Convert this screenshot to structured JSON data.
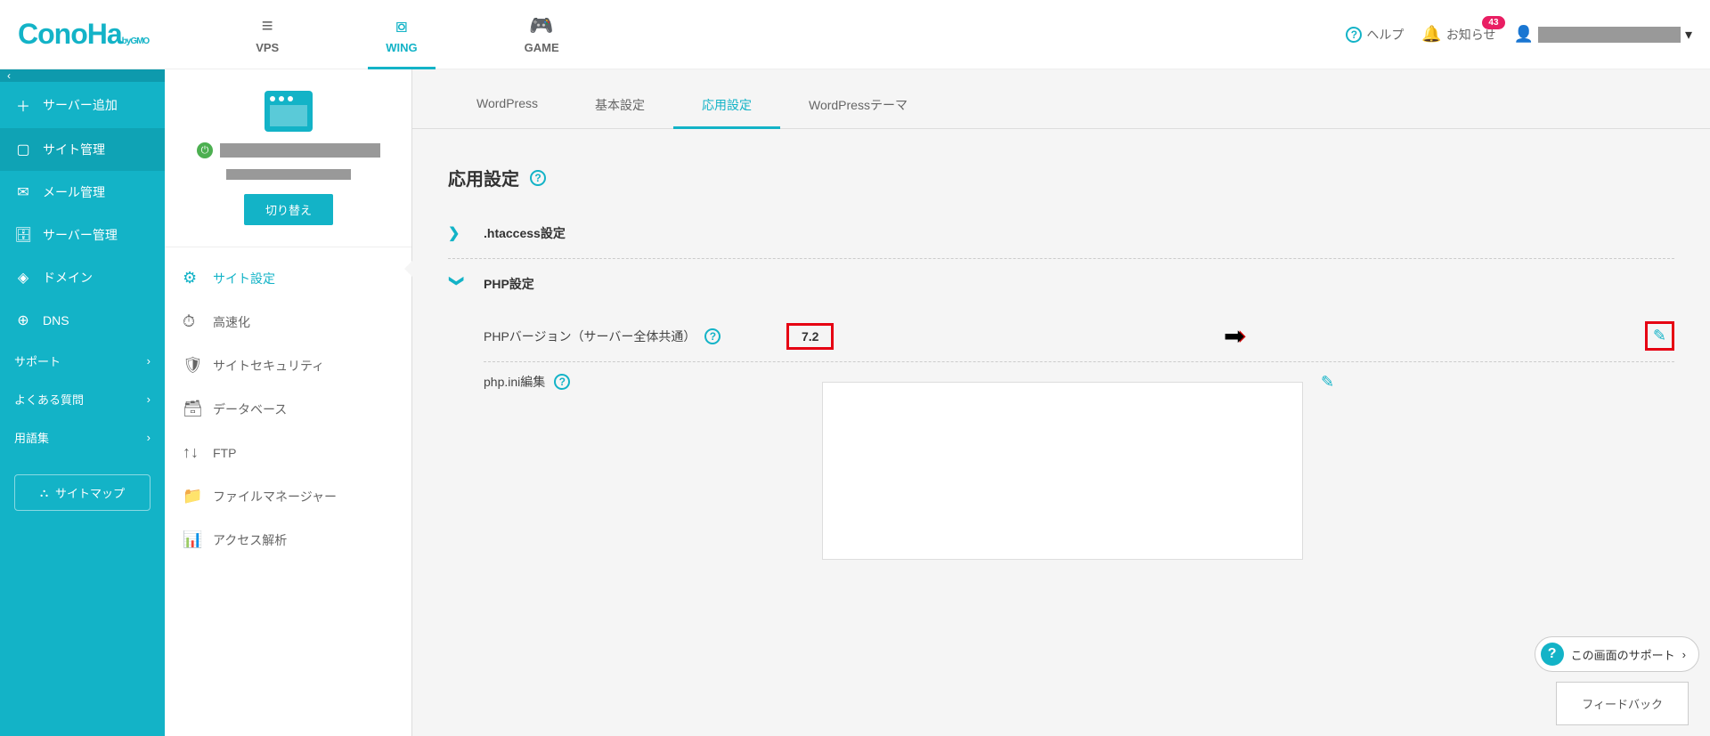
{
  "logo": {
    "main": "ConoHa",
    "sub": "byGMO"
  },
  "topNav": [
    {
      "label": "VPS",
      "icon": "≡"
    },
    {
      "label": "WING",
      "icon": "⧇",
      "active": true
    },
    {
      "label": "GAME",
      "icon": "🎮"
    }
  ],
  "header": {
    "help": "ヘルプ",
    "notifications": "お知らせ",
    "notifCount": "43"
  },
  "sidebarLeft": {
    "items": [
      {
        "icon": "＋",
        "label": "サーバー追加"
      },
      {
        "icon": "▢",
        "label": "サイト管理",
        "active": true
      },
      {
        "icon": "✉",
        "label": "メール管理"
      },
      {
        "icon": "🗄",
        "label": "サーバー管理"
      },
      {
        "icon": "◈",
        "label": "ドメイン"
      },
      {
        "icon": "⊕",
        "label": "DNS"
      }
    ],
    "subs": [
      {
        "label": "サポート"
      },
      {
        "label": "よくある質問"
      },
      {
        "label": "用語集"
      }
    ],
    "sitemap": "サイトマップ"
  },
  "sidebarMid": {
    "switchLabel": "切り替え",
    "items": [
      {
        "icon": "⚙",
        "label": "サイト設定",
        "active": true
      },
      {
        "icon": "⏱",
        "label": "高速化"
      },
      {
        "icon": "🛡",
        "label": "サイトセキュリティ"
      },
      {
        "icon": "🗃",
        "label": "データベース"
      },
      {
        "icon": "↑↓",
        "label": "FTP"
      },
      {
        "icon": "📁",
        "label": "ファイルマネージャー"
      },
      {
        "icon": "📊",
        "label": "アクセス解析"
      }
    ]
  },
  "mainTabs": [
    {
      "label": "WordPress"
    },
    {
      "label": "基本設定"
    },
    {
      "label": "応用設定",
      "active": true
    },
    {
      "label": "WordPressテーマ"
    }
  ],
  "section": {
    "title": "応用設定"
  },
  "accordion": [
    {
      "title": ".htaccess設定",
      "open": false
    },
    {
      "title": "PHP設定",
      "open": true
    }
  ],
  "phpSettings": {
    "versionLabel": "PHPバージョン（サーバー全体共通）",
    "versionValue": "7.2",
    "iniLabel": "php.ini編集"
  },
  "supportPill": "この画面のサポート",
  "feedback": "フィードバック"
}
